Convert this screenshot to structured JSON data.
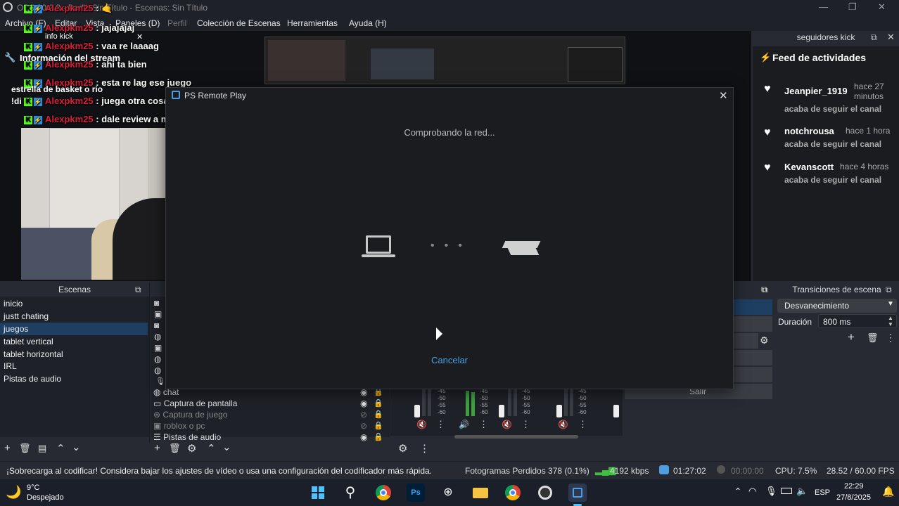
{
  "window": {
    "title": "OBS 30.2.3 - Perfil: Sin Título - Escenas: Sin Título",
    "controls": [
      "—",
      "❐",
      "✕"
    ]
  },
  "menu": {
    "items": [
      {
        "label": "Archivo (F)",
        "disabled": false
      },
      {
        "label": "Editar",
        "disabled": false
      },
      {
        "label": "Vista",
        "disabled": false
      },
      {
        "label": "Paneles (D)",
        "disabled": false
      },
      {
        "label": "Perfil",
        "disabled": true
      },
      {
        "label": "Colección de Escenas",
        "disabled": false
      },
      {
        "label": "Herramientas",
        "disabled": false
      },
      {
        "label": "Ayuda (H)",
        "disabled": false
      }
    ]
  },
  "overlay": {
    "info_kick_label": "info kick",
    "stream_info_title": "Información del stream",
    "stream_info_text": "estrella de basket o rio",
    "command_text": "!di",
    "chat": [
      {
        "user": "Alexpkm25",
        "message": "🤙"
      },
      {
        "user": "Alexpkm25",
        "message": "jajajajaj"
      },
      {
        "user": "Alexpkm25",
        "message": "vaa re laaaag"
      },
      {
        "user": "Alexpkm25",
        "message": "ahi ta bien"
      },
      {
        "user": "Alexpkm25",
        "message": "esta re lag ese juego"
      },
      {
        "user": "Alexpkm25",
        "message": "juega otra cosa"
      },
      {
        "user": "Alexpkm25",
        "message": "dale review a mi per"
      }
    ]
  },
  "ps_remote_play": {
    "title": "PS Remote Play",
    "status": "Comprobando la red...",
    "cancel_label": "Cancelar"
  },
  "feed": {
    "dock_title": "seguidores kick",
    "title": "Feed de actividades",
    "items": [
      {
        "name": "Jeanpier_1919",
        "time": "hace 27 minutos",
        "action": "acaba de seguir el canal"
      },
      {
        "name": "notchrousa",
        "time": "hace 1 hora",
        "action": "acaba de seguir el canal"
      },
      {
        "name": "Kevanscott",
        "time": "hace 4 horas",
        "action": "acaba de seguir el canal"
      }
    ]
  },
  "scenes": {
    "title": "Escenas",
    "items": [
      "inicio",
      "justt chating",
      "juegos",
      "tablet vertical",
      "tablet horizontal",
      "IRL",
      "Pistas de audio"
    ],
    "active_index": 2
  },
  "sources": {
    "items": [
      {
        "label": "chat",
        "dim": false
      },
      {
        "label": "Captura de pantalla",
        "dim": false
      },
      {
        "label": "Captura de juego",
        "dim": true
      },
      {
        "label": "roblox o pc",
        "dim": true
      },
      {
        "label": "Pistas de audio",
        "dim": false
      }
    ]
  },
  "mixer": {
    "scale": [
      "-45",
      "-50",
      "-55",
      "-60"
    ]
  },
  "controls": {
    "partial_label": "Salir"
  },
  "transitions": {
    "title": "Transiciones de escena",
    "selected": "Desvanecimiento",
    "duration_label": "Duración",
    "duration_value": "800 ms"
  },
  "status": {
    "warning": "¡Sobrecarga al codificar! Considera bajar los ajustes de vídeo o usa una configuración del codificador más rápida.",
    "dropped_frames": "Fotogramas Perdidos 378 (0.1%)",
    "bitrate": "4192 kbps",
    "stream_time": "01:27:02",
    "record_time": "00:00:00",
    "cpu": "CPU: 7.5%",
    "fps": "28.52 / 60.00 FPS"
  },
  "taskbar": {
    "weather_temp": "9°C",
    "weather_desc": "Despejado",
    "language": "ESP",
    "time": "22:29",
    "date": "27/8/2025"
  },
  "colors": {
    "accent": "#4d9de0",
    "kick_green": "#53fc18",
    "username_red": "#d9203a",
    "selection": "#1e3e62"
  }
}
